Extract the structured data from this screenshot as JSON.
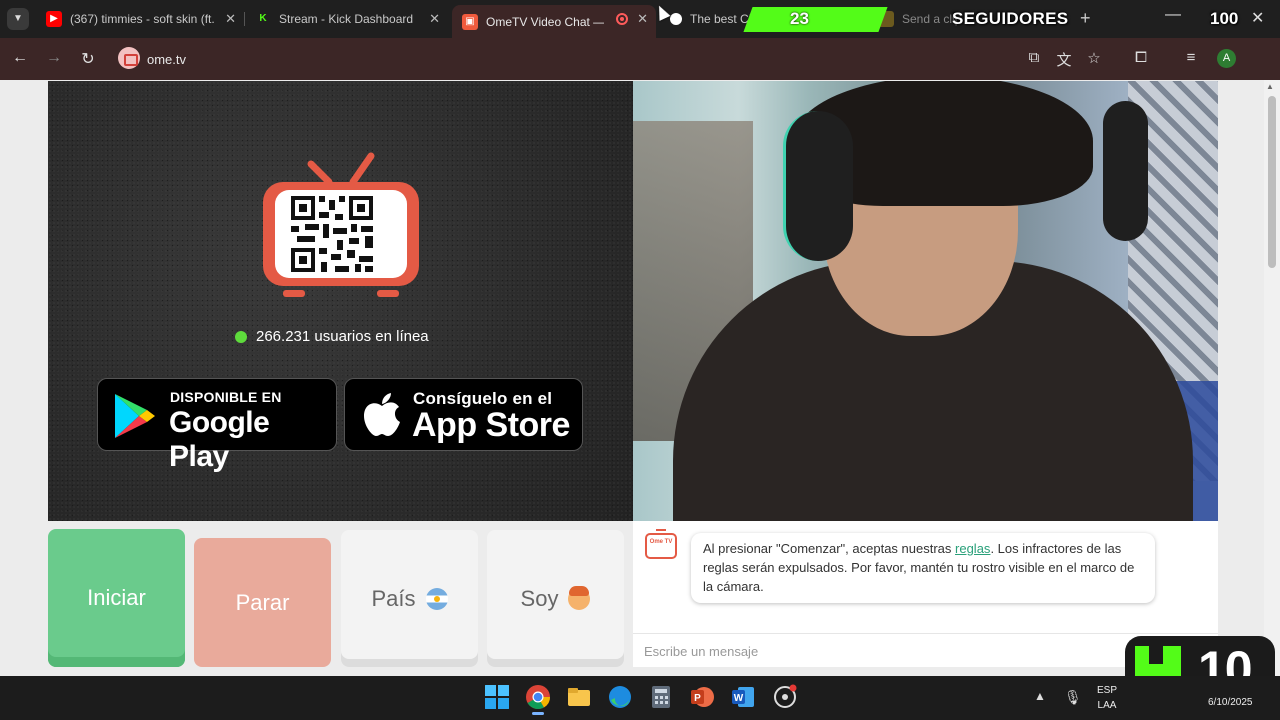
{
  "browser": {
    "tabs": [
      {
        "title": "(367) timmies - soft skin (ft.",
        "favicon": "youtube-icon"
      },
      {
        "title": "Stream - Kick Dashboard",
        "favicon": "kick-icon"
      },
      {
        "title": "OmeTV Video Chat — O",
        "favicon": "ometv-icon",
        "active": true,
        "recording": true
      },
      {
        "title": "The best ChatR",
        "favicon": "chatr-icon"
      },
      {
        "title": "Send a clip",
        "favicon": "clip-icon"
      }
    ],
    "url": "ome.tv",
    "profile_initial": "A"
  },
  "overlay": {
    "followers_count": "23",
    "followers_label": "SEGUIDORES",
    "followers_goal": "100",
    "kick_viewers": "10",
    "accent": "#53fc18"
  },
  "ometv": {
    "online_text": "266.231 usuarios en línea",
    "google_play": {
      "small": "DISPONIBLE EN",
      "big": "Google Play"
    },
    "app_store": {
      "small": "Consíguelo en el",
      "big": "App Store"
    },
    "buttons": {
      "start": "Iniciar",
      "stop": "Parar",
      "country": "País",
      "gender": "Soy"
    },
    "chat": {
      "logo_text": "Ome TV",
      "message_pre": "Al presionar \"Comenzar\", aceptas nuestras ",
      "message_link": "reglas",
      "message_post": ". Los infractores de las reglas serán expulsados. Por favor, mantén tu rostro visible en el marco de la cámara.",
      "input_placeholder": "Escribe un mensaje"
    }
  },
  "taskbar": {
    "lang_line1": "ESP",
    "lang_line2": "LAA",
    "date": "6/10/2025"
  }
}
